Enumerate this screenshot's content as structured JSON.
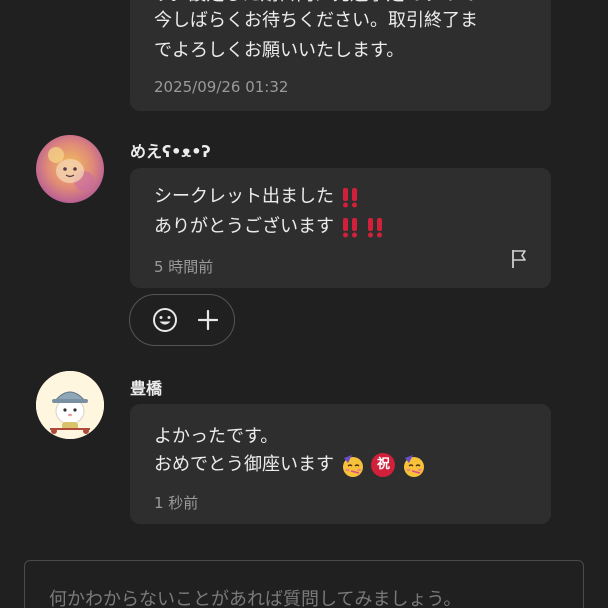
{
  "messages": [
    {
      "text_partial_top": "す。設定した期日内に発送予定ですので",
      "text": "今しばらくお待ちください。取引終了ま\nでよろしくお願いいたします。",
      "time": "2025/09/26 01:32"
    },
    {
      "author": "めえʕ•ᴥ•ʔ",
      "text_line1": "シークレット出ました",
      "text_line2": "ありがとうございます",
      "time": "5 時間前"
    },
    {
      "author": "豊橋",
      "text_line1": "よかったです。",
      "text_line2": "おめでとう御座います",
      "celebration_char": "祝",
      "time": "1 秒前"
    }
  ],
  "reactions": {
    "smile_icon": "smile-icon",
    "add_icon": "plus-icon"
  },
  "input": {
    "placeholder": "何かわからないことがあれば質問してみましょう。"
  },
  "colors": {
    "background": "#202020",
    "bubble": "#2e2e2e",
    "accent_red": "#d0203a"
  }
}
